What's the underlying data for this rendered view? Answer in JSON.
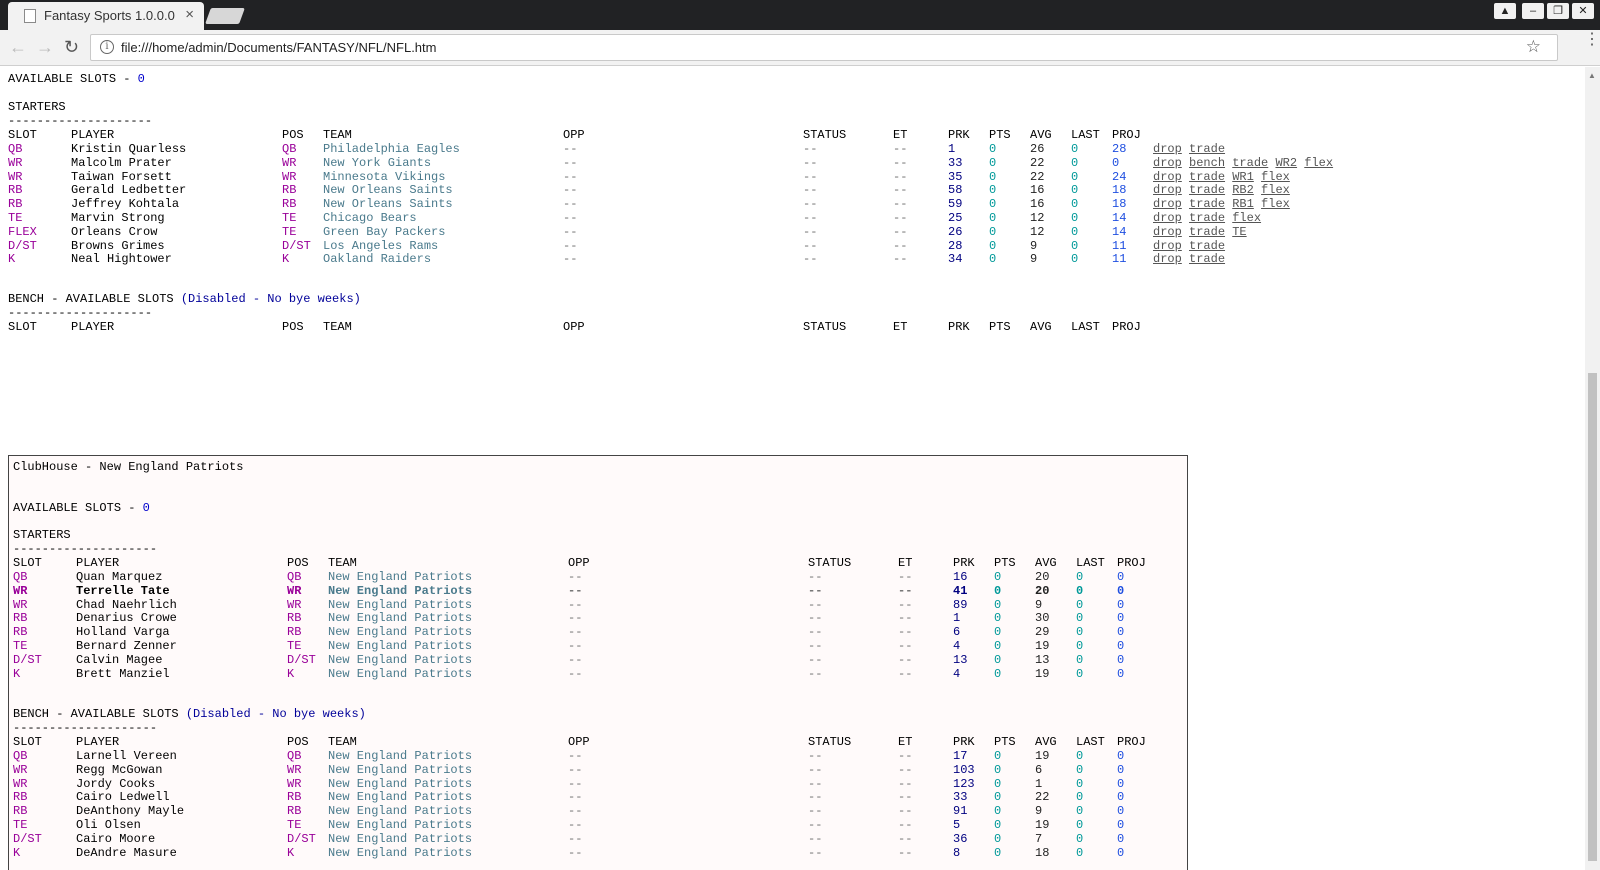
{
  "browser": {
    "tab_title": "Fantasy Sports 1.0.0.0",
    "tab_close": "×",
    "url": "file:///home/admin/Documents/FANTASY/NFL/NFL.htm",
    "info_glyph": "i",
    "star_glyph": "☆",
    "back_glyph": "←",
    "forward_glyph": "→",
    "reload_glyph": "↻",
    "menu_glyph": "⋮",
    "win_user": "▲",
    "win_min": "–",
    "win_max": "❐",
    "win_close": "✕"
  },
  "my_team": {
    "available_label": "AVAILABLE SLOTS - ",
    "available_count": "0",
    "starters_heading": "STARTERS",
    "divider": "--------------------",
    "bench_heading": "BENCH - AVAILABLE SLOTS ",
    "bench_note": "(Disabled - No bye weeks)",
    "columns": [
      "SLOT",
      "PLAYER",
      "POS",
      "TEAM",
      "OPP",
      "STATUS",
      "ET",
      "PRK",
      "PTS",
      "AVG",
      "LAST",
      "PROJ"
    ],
    "starters": [
      {
        "slot": "QB",
        "player": "Kristin Quarless",
        "pos": "QB",
        "team": "Philadelphia Eagles",
        "opp": "--",
        "status": "--",
        "et": "--",
        "prk": "1",
        "pts": "0",
        "avg": "26",
        "last": "0",
        "proj": "28",
        "actions": [
          "drop",
          "trade"
        ]
      },
      {
        "slot": "WR",
        "player": "Malcolm Prater",
        "pos": "WR",
        "team": "New York Giants",
        "opp": "--",
        "status": "--",
        "et": "--",
        "prk": "33",
        "pts": "0",
        "avg": "22",
        "last": "0",
        "proj": "0",
        "actions": [
          "drop",
          "bench",
          "trade",
          "WR2",
          "flex"
        ]
      },
      {
        "slot": "WR",
        "player": "Taiwan Forsett",
        "pos": "WR",
        "team": "Minnesota Vikings",
        "opp": "--",
        "status": "--",
        "et": "--",
        "prk": "35",
        "pts": "0",
        "avg": "22",
        "last": "0",
        "proj": "24",
        "actions": [
          "drop",
          "trade",
          "WR1",
          "flex"
        ]
      },
      {
        "slot": "RB",
        "player": "Gerald Ledbetter",
        "pos": "RB",
        "team": "New Orleans Saints",
        "opp": "--",
        "status": "--",
        "et": "--",
        "prk": "58",
        "pts": "0",
        "avg": "16",
        "last": "0",
        "proj": "18",
        "actions": [
          "drop",
          "trade",
          "RB2",
          "flex"
        ]
      },
      {
        "slot": "RB",
        "player": "Jeffrey Kohtala",
        "pos": "RB",
        "team": "New Orleans Saints",
        "opp": "--",
        "status": "--",
        "et": "--",
        "prk": "59",
        "pts": "0",
        "avg": "16",
        "last": "0",
        "proj": "18",
        "actions": [
          "drop",
          "trade",
          "RB1",
          "flex"
        ]
      },
      {
        "slot": "TE",
        "player": "Marvin Strong",
        "pos": "TE",
        "team": "Chicago Bears",
        "opp": "--",
        "status": "--",
        "et": "--",
        "prk": "25",
        "pts": "0",
        "avg": "12",
        "last": "0",
        "proj": "14",
        "actions": [
          "drop",
          "trade",
          "flex"
        ]
      },
      {
        "slot": "FLEX",
        "player": "Orleans Crow",
        "pos": "TE",
        "team": "Green Bay Packers",
        "opp": "--",
        "status": "--",
        "et": "--",
        "prk": "26",
        "pts": "0",
        "avg": "12",
        "last": "0",
        "proj": "14",
        "actions": [
          "drop",
          "trade",
          "TE"
        ]
      },
      {
        "slot": "D/ST",
        "player": "Browns Grimes",
        "pos": "D/ST",
        "team": "Los Angeles Rams",
        "opp": "--",
        "status": "--",
        "et": "--",
        "prk": "28",
        "pts": "0",
        "avg": "9",
        "last": "0",
        "proj": "11",
        "actions": [
          "drop",
          "trade"
        ]
      },
      {
        "slot": "K",
        "player": "Neal Hightower",
        "pos": "K",
        "team": "Oakland Raiders",
        "opp": "--",
        "status": "--",
        "et": "--",
        "prk": "34",
        "pts": "0",
        "avg": "9",
        "last": "0",
        "proj": "11",
        "actions": [
          "drop",
          "trade"
        ]
      }
    ]
  },
  "clubhouse": {
    "title": "ClubHouse - New England Patriots",
    "available_label": "AVAILABLE SLOTS - ",
    "available_count": "0",
    "starters_heading": "STARTERS",
    "divider": "--------------------",
    "bench_heading": "BENCH - AVAILABLE SLOTS ",
    "bench_note": "(Disabled - No bye weeks)",
    "starters": [
      {
        "slot": "QB",
        "player": "Quan Marquez",
        "pos": "QB",
        "team": "New England Patriots",
        "opp": "--",
        "status": "--",
        "et": "--",
        "prk": "16",
        "pts": "0",
        "avg": "20",
        "last": "0",
        "proj": "0"
      },
      {
        "slot": "WR",
        "player": "Terrelle Tate",
        "pos": "WR",
        "team": "New England Patriots",
        "opp": "--",
        "status": "--",
        "et": "--",
        "prk": "41",
        "pts": "0",
        "avg": "20",
        "last": "0",
        "proj": "0",
        "bold": true
      },
      {
        "slot": "WR",
        "player": "Chad Naehrlich",
        "pos": "WR",
        "team": "New England Patriots",
        "opp": "--",
        "status": "--",
        "et": "--",
        "prk": "89",
        "pts": "0",
        "avg": "9",
        "last": "0",
        "proj": "0"
      },
      {
        "slot": "RB",
        "player": "Denarius Crowe",
        "pos": "RB",
        "team": "New England Patriots",
        "opp": "--",
        "status": "--",
        "et": "--",
        "prk": "1",
        "pts": "0",
        "avg": "30",
        "last": "0",
        "proj": "0"
      },
      {
        "slot": "RB",
        "player": "Holland Varga",
        "pos": "RB",
        "team": "New England Patriots",
        "opp": "--",
        "status": "--",
        "et": "--",
        "prk": "6",
        "pts": "0",
        "avg": "29",
        "last": "0",
        "proj": "0"
      },
      {
        "slot": "TE",
        "player": "Bernard Zenner",
        "pos": "TE",
        "team": "New England Patriots",
        "opp": "--",
        "status": "--",
        "et": "--",
        "prk": "4",
        "pts": "0",
        "avg": "19",
        "last": "0",
        "proj": "0"
      },
      {
        "slot": "D/ST",
        "player": "Calvin Magee",
        "pos": "D/ST",
        "team": "New England Patriots",
        "opp": "--",
        "status": "--",
        "et": "--",
        "prk": "13",
        "pts": "0",
        "avg": "13",
        "last": "0",
        "proj": "0"
      },
      {
        "slot": "K",
        "player": "Brett Manziel",
        "pos": "K",
        "team": "New England Patriots",
        "opp": "--",
        "status": "--",
        "et": "--",
        "prk": "4",
        "pts": "0",
        "avg": "19",
        "last": "0",
        "proj": "0"
      }
    ],
    "bench": [
      {
        "slot": "QB",
        "player": "Larnell Vereen",
        "pos": "QB",
        "team": "New England Patriots",
        "opp": "--",
        "status": "--",
        "et": "--",
        "prk": "17",
        "pts": "0",
        "avg": "19",
        "last": "0",
        "proj": "0"
      },
      {
        "slot": "WR",
        "player": "Regg McGowan",
        "pos": "WR",
        "team": "New England Patriots",
        "opp": "--",
        "status": "--",
        "et": "--",
        "prk": "103",
        "pts": "0",
        "avg": "6",
        "last": "0",
        "proj": "0"
      },
      {
        "slot": "WR",
        "player": "Jordy Cooks",
        "pos": "WR",
        "team": "New England Patriots",
        "opp": "--",
        "status": "--",
        "et": "--",
        "prk": "123",
        "pts": "0",
        "avg": "1",
        "last": "0",
        "proj": "0"
      },
      {
        "slot": "RB",
        "player": "Cairo Ledwell",
        "pos": "RB",
        "team": "New England Patriots",
        "opp": "--",
        "status": "--",
        "et": "--",
        "prk": "33",
        "pts": "0",
        "avg": "22",
        "last": "0",
        "proj": "0"
      },
      {
        "slot": "RB",
        "player": "DeAnthony Mayle",
        "pos": "RB",
        "team": "New England Patriots",
        "opp": "--",
        "status": "--",
        "et": "--",
        "prk": "91",
        "pts": "0",
        "avg": "9",
        "last": "0",
        "proj": "0"
      },
      {
        "slot": "TE",
        "player": "Oli Olsen",
        "pos": "TE",
        "team": "New England Patriots",
        "opp": "--",
        "status": "--",
        "et": "--",
        "prk": "5",
        "pts": "0",
        "avg": "19",
        "last": "0",
        "proj": "0"
      },
      {
        "slot": "D/ST",
        "player": "Cairo Moore",
        "pos": "D/ST",
        "team": "New England Patriots",
        "opp": "--",
        "status": "--",
        "et": "--",
        "prk": "36",
        "pts": "0",
        "avg": "7",
        "last": "0",
        "proj": "0"
      },
      {
        "slot": "K",
        "player": "DeAndre Masure",
        "pos": "K",
        "team": "New England Patriots",
        "opp": "--",
        "status": "--",
        "et": "--",
        "prk": "8",
        "pts": "0",
        "avg": "18",
        "last": "0",
        "proj": "0"
      }
    ]
  }
}
